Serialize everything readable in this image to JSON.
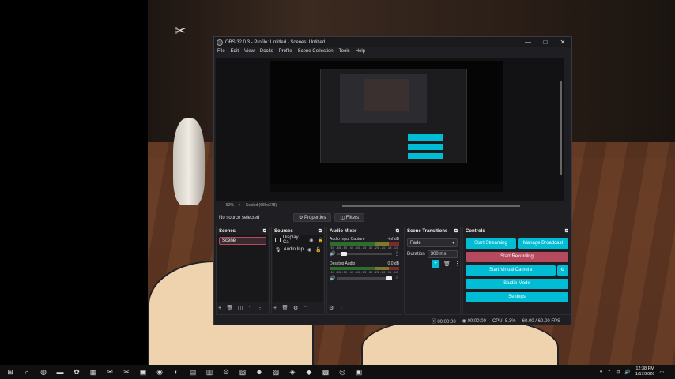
{
  "obs": {
    "title": "OBS 32.0.3 - Profile: Untitled - Scenes: Untitled",
    "window_buttons": [
      "—",
      "□",
      "✕"
    ],
    "menu": [
      "File",
      "Edit",
      "View",
      "Docks",
      "Profile",
      "Scene Collection",
      "Tools",
      "Help"
    ],
    "preview_bar": {
      "zoom": "52%",
      "scale_label": "Scaled (680x378)"
    },
    "source_bar": {
      "no_source": "No source selected",
      "properties": "Properties",
      "filters": "Filters"
    },
    "scenes": {
      "header": "Scenes",
      "items": [
        "Scene"
      ]
    },
    "sources": {
      "header": "Sources",
      "items": [
        "Display Ca",
        "Audio Inp"
      ]
    },
    "audio_mixer": {
      "header": "Audio Mixer",
      "tracks": [
        {
          "name": "Audio Input Capture",
          "level": "-inf dB",
          "volume": 0.05
        },
        {
          "name": "Desktop Audio",
          "level": "0.0 dB",
          "volume": 1.0
        }
      ],
      "ticks": "-60 -55 -50 -45 -40 -35 -30 -25 -20 -15 -10 -5 0"
    },
    "transitions": {
      "header": "Scene Transitions",
      "selected": "Fade",
      "duration_label": "Duration",
      "duration": "300 ms"
    },
    "controls": {
      "header": "Controls",
      "start_streaming": "Start Streaming",
      "manage_broadcast": "Manage Broadcast",
      "start_recording": "Start Recording",
      "start_virtual_camera": "Start Virtual Camera",
      "studio_mode": "Studio Mode",
      "settings": "Settings"
    },
    "status": {
      "stream_time": "00:00:00",
      "rec_time": "00:00:00",
      "cpu": "CPU: 5.3%",
      "fps": "60.00 / 60.00 FPS"
    }
  },
  "taskbar": {
    "time": "12:38 PM",
    "date": "1/17/2026"
  },
  "colors": {
    "accent": "#00bcd4",
    "record": "#b54a5e",
    "window": "#1f1f23"
  }
}
